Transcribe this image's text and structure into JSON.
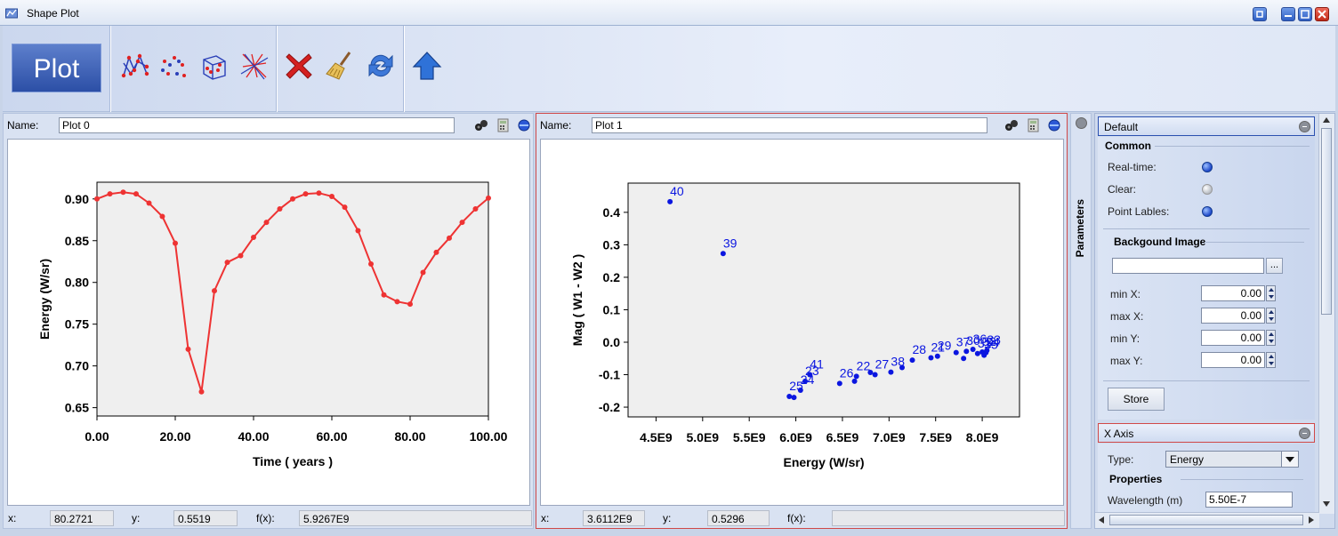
{
  "window": {
    "title": "Shape Plot"
  },
  "toolbar": {
    "plot_label": "Plot",
    "icons": [
      "line-plot-icon",
      "scatter-plot-icon",
      "cube-plot-icon",
      "cross-lines-icon",
      "delete-icon",
      "clear-broom-icon",
      "refresh-icon",
      "up-arrow-icon"
    ]
  },
  "panels": [
    {
      "name_label": "Name:",
      "name_value": "Plot 0",
      "status": {
        "x_label": "x:",
        "x_value": "80.2721",
        "y_label": "y:",
        "y_value": "0.5519",
        "fx_label": "f(x):",
        "fx_value": "5.9267E9"
      }
    },
    {
      "name_label": "Name:",
      "name_value": "Plot 1",
      "status": {
        "x_label": "x:",
        "x_value": "3.6112E9",
        "y_label": "y:",
        "y_value": "0.5296",
        "fx_label": "f(x):",
        "fx_value": ""
      }
    }
  ],
  "chart_data": [
    {
      "type": "line",
      "title": "",
      "xlabel": "Time ( years )",
      "ylabel": "Energy (W/sr)",
      "xlim": [
        0,
        100
      ],
      "ylim": [
        0.64,
        0.92
      ],
      "xticks": [
        "0.00",
        "20.00",
        "40.00",
        "60.00",
        "80.00",
        "100.00"
      ],
      "yticks": [
        "0.65",
        "0.70",
        "0.75",
        "0.80",
        "0.85",
        "0.90"
      ],
      "color": "#ee3333",
      "x": [
        0,
        3.3,
        6.7,
        10,
        13.3,
        16.7,
        20,
        23.3,
        26.7,
        30,
        33.3,
        36.7,
        40,
        43.3,
        46.7,
        50,
        53.3,
        56.7,
        60,
        63.3,
        66.7,
        70,
        73.3,
        76.7,
        80,
        83.3,
        86.7,
        90,
        93.3,
        96.7,
        100
      ],
      "y": [
        0.9,
        0.906,
        0.908,
        0.906,
        0.895,
        0.879,
        0.847,
        0.72,
        0.669,
        0.79,
        0.824,
        0.832,
        0.854,
        0.872,
        0.888,
        0.9,
        0.906,
        0.907,
        0.903,
        0.89,
        0.862,
        0.822,
        0.785,
        0.777,
        0.774,
        0.812,
        0.836,
        0.853,
        0.872,
        0.888,
        0.901
      ]
    },
    {
      "type": "scatter",
      "title": "",
      "xlabel": "Energy (W/sr)",
      "ylabel": "Mag ( W1 - W2 )",
      "xlim": [
        4200000000.0,
        8400000000.0
      ],
      "ylim": [
        -0.23,
        0.49
      ],
      "xticks": [
        "4.5E9",
        "5.0E9",
        "5.5E9",
        "6.0E9",
        "6.5E9",
        "7.0E9",
        "7.5E9",
        "8.0E9"
      ],
      "xtick_values": [
        4500000000.0,
        5000000000.0,
        5500000000.0,
        6000000000.0,
        6500000000.0,
        7000000000.0,
        7500000000.0,
        8000000000.0
      ],
      "yticks": [
        "0.4",
        "0.3",
        "0.2",
        "0.1",
        "0.0",
        "-0.1",
        "-0.2"
      ],
      "ytick_values": [
        0.4,
        0.3,
        0.2,
        0.1,
        0.0,
        -0.1,
        -0.2
      ],
      "color": "#0b16e0",
      "points": [
        {
          "x": 4650000000.0,
          "y": 0.433,
          "label": "40"
        },
        {
          "x": 5220000000.0,
          "y": 0.273,
          "label": "39"
        },
        {
          "x": 5930000000.0,
          "y": -0.167,
          "label": "25"
        },
        {
          "x": 5980000000.0,
          "y": -0.17,
          "label": ""
        },
        {
          "x": 6050000000.0,
          "y": -0.148,
          "label": "24"
        },
        {
          "x": 6100000000.0,
          "y": -0.12,
          "label": "23"
        },
        {
          "x": 6150000000.0,
          "y": -0.1,
          "label": "41"
        },
        {
          "x": 6470000000.0,
          "y": -0.127,
          "label": "26"
        },
        {
          "x": 6630000000.0,
          "y": -0.12,
          "label": ""
        },
        {
          "x": 6650000000.0,
          "y": -0.105,
          "label": "22"
        },
        {
          "x": 6800000000.0,
          "y": -0.093,
          "label": ""
        },
        {
          "x": 6850000000.0,
          "y": -0.1,
          "label": "27"
        },
        {
          "x": 7020000000.0,
          "y": -0.092,
          "label": "38"
        },
        {
          "x": 7140000000.0,
          "y": -0.078,
          "label": ""
        },
        {
          "x": 7250000000.0,
          "y": -0.055,
          "label": "28"
        },
        {
          "x": 7450000000.0,
          "y": -0.048,
          "label": "21"
        },
        {
          "x": 7520000000.0,
          "y": -0.043,
          "label": "29"
        },
        {
          "x": 7720000000.0,
          "y": -0.032,
          "label": "37"
        },
        {
          "x": 7800000000.0,
          "y": -0.05,
          "label": ""
        },
        {
          "x": 7830000000.0,
          "y": -0.028,
          "label": "30"
        },
        {
          "x": 7900000000.0,
          "y": -0.022,
          "label": "36"
        },
        {
          "x": 7950000000.0,
          "y": -0.035,
          "label": "31"
        },
        {
          "x": 8000000000.0,
          "y": -0.03,
          "label": "32"
        },
        {
          "x": 8020000000.0,
          "y": -0.04,
          "label": "35"
        },
        {
          "x": 8040000000.0,
          "y": -0.032,
          "label": "34"
        },
        {
          "x": 8050000000.0,
          "y": -0.025,
          "label": "33"
        }
      ]
    }
  ],
  "params": {
    "strip_label": "Parameters",
    "default_section": "Default",
    "common_group": "Common",
    "realtime_label": "Real-time:",
    "clear_label": "Clear:",
    "point_labels_label": "Point Lables:",
    "bg_group": "Backgound Image",
    "bg_path": "",
    "browse_label": "...",
    "min_x_label": "min X:",
    "min_x": "0.00",
    "max_x_label": "max X:",
    "max_x": "0.00",
    "min_y_label": "min Y:",
    "min_y": "0.00",
    "max_y_label": "max Y:",
    "max_y": "0.00",
    "store_label": "Store",
    "xaxis_section": "X Axis",
    "type_label": "Type:",
    "type_value": "Energy",
    "properties_group": "Properties",
    "wavelength_label": "Wavelength (m)",
    "wavelength_value": "5.50E-7"
  }
}
